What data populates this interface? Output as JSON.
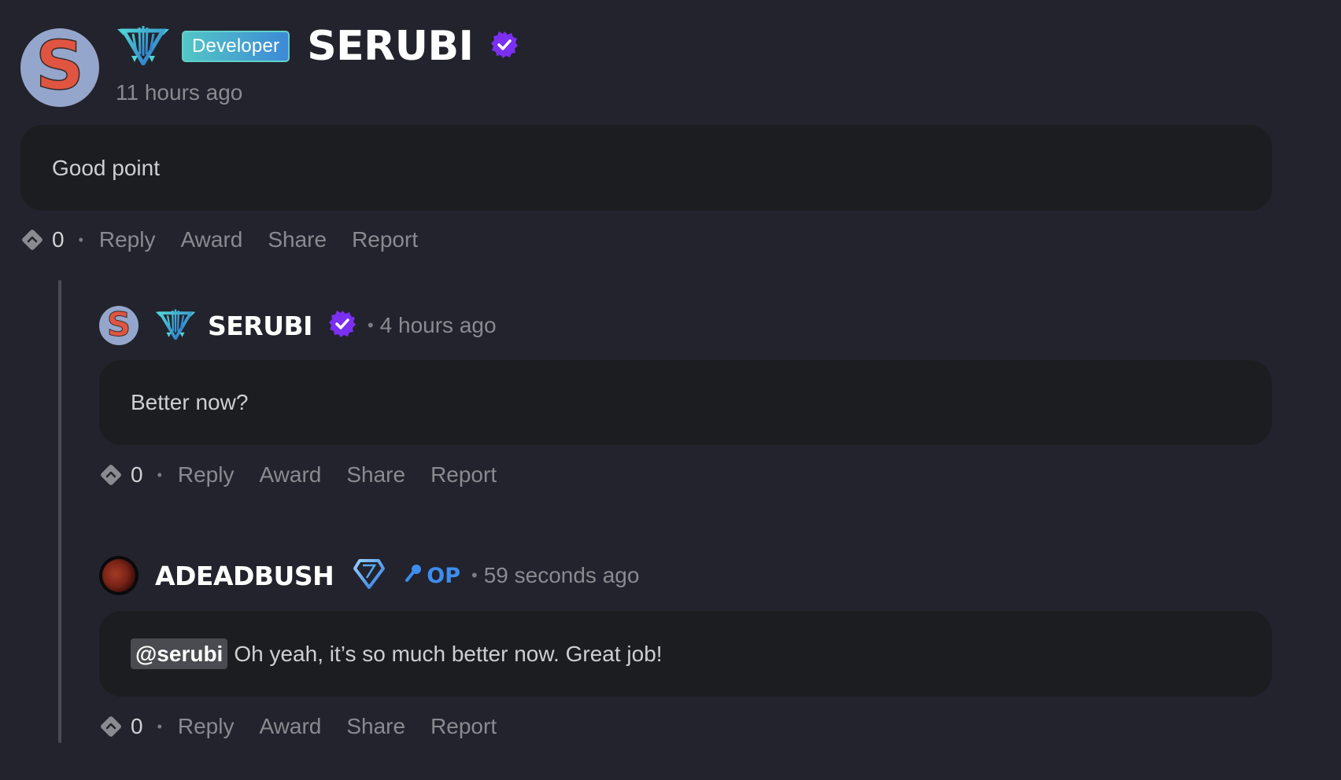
{
  "comment": {
    "author": "SERUBI",
    "role_badge": "Developer",
    "rank_icon": "crest-rank-icon",
    "verified": true,
    "verified_color": "#7b2ff0",
    "time": "11 hours ago",
    "body": "Good point",
    "votes": "0",
    "actions": [
      "Reply",
      "Award",
      "Share",
      "Report"
    ]
  },
  "replies": [
    {
      "author": "SERUBI",
      "avatar_letter": "S",
      "rank_icon": "crest-rank-icon",
      "verified": true,
      "separator": "•",
      "time": "4 hours ago",
      "body": "Better now?",
      "votes": "0",
      "actions": [
        "Reply",
        "Award",
        "Share",
        "Report"
      ]
    },
    {
      "author": "ADEADBUSH",
      "avatar": "blood-moon",
      "rank_icon": "diamond-rank-icon",
      "op_label": "OP",
      "op_icon": "microphone-icon",
      "separator": "•",
      "time": "59 seconds ago",
      "mention": "@serubi",
      "body": "Oh yeah, it’s so much better now. Great job!",
      "votes": "0",
      "actions": [
        "Reply",
        "Award",
        "Share",
        "Report"
      ]
    }
  ],
  "main_avatar_letter": "S",
  "action_separator": "•",
  "colors": {
    "background": "#22232c",
    "card": "#1c1d21",
    "op_blue": "#3e8df0",
    "verified_purple": "#7b2ff0",
    "badge_gradient_start": "#53c6c6",
    "badge_gradient_end": "#3d8ad6"
  }
}
